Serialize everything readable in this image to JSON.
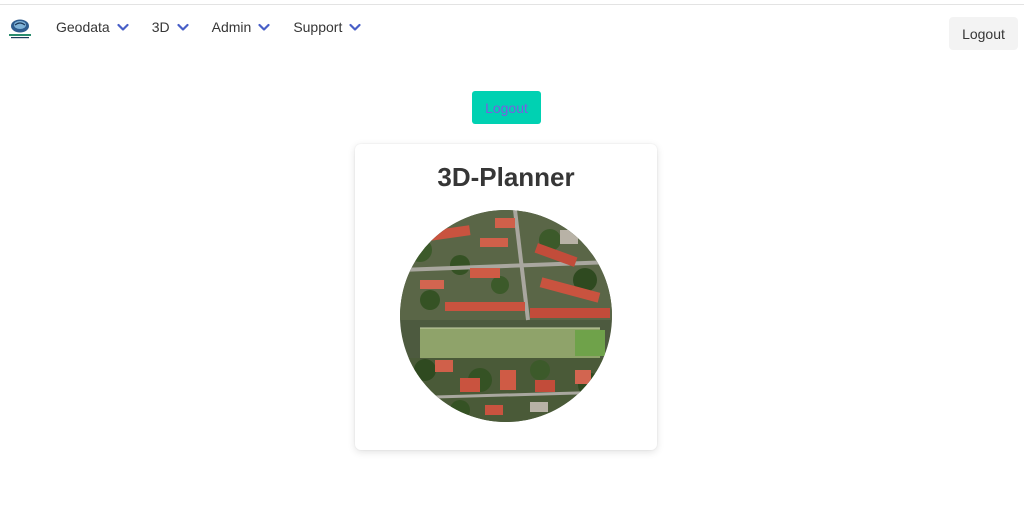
{
  "navbar": {
    "logo_icon": "logo-icon",
    "items": [
      {
        "label": "Geodata",
        "icon": "chevron-down-icon"
      },
      {
        "label": "3D",
        "icon": "chevron-down-icon"
      },
      {
        "label": "Admin",
        "icon": "chevron-down-icon"
      },
      {
        "label": "Support",
        "icon": "chevron-down-icon"
      }
    ],
    "logout_label": "Logout"
  },
  "main": {
    "logout_label": "Logout",
    "card": {
      "title": "3D-Planner",
      "image_icon": "aerial-city-image"
    }
  },
  "colors": {
    "accent": "#00d1b2",
    "chevron": "#485fc7",
    "text": "#363636"
  }
}
